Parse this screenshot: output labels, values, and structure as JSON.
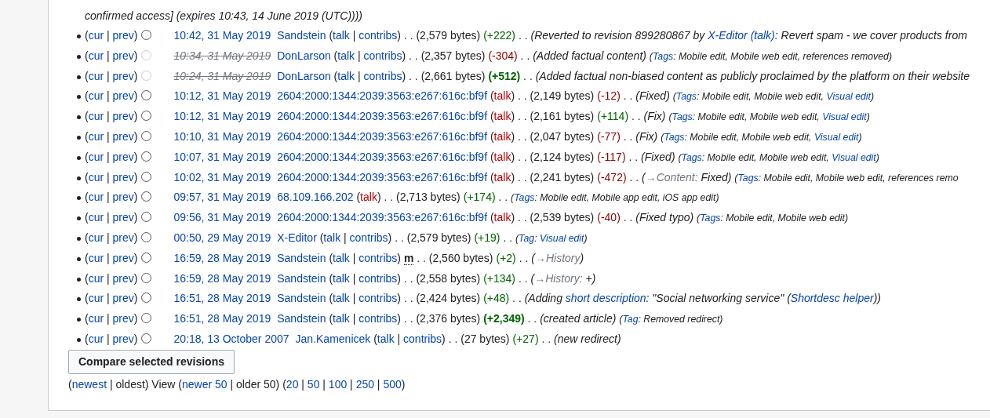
{
  "continuation": [
    {
      "kind": "comment",
      "text": "confirmed access] (expires 10:43, 14 June 2019 (UTC))))"
    }
  ],
  "rows": [
    {
      "segments": [
        {
          "kind": "punct",
          "text": "("
        },
        {
          "kind": "link",
          "text": "cur"
        },
        {
          "kind": "punct",
          "text": " | "
        },
        {
          "kind": "link",
          "text": "prev"
        },
        {
          "kind": "punct",
          "text": ")"
        },
        {
          "kind": "radio",
          "disabled": false
        },
        {
          "kind": "date",
          "text": "10:42, 31 May 2019"
        },
        {
          "kind": "link",
          "text": "Sandstein"
        },
        {
          "kind": "punct",
          "text": " ("
        },
        {
          "kind": "link",
          "text": "talk"
        },
        {
          "kind": "punct",
          "text": " | "
        },
        {
          "kind": "link",
          "text": "contribs"
        },
        {
          "kind": "punct",
          "text": ") . . "
        },
        {
          "kind": "size",
          "text": "(2,579 bytes)"
        },
        {
          "kind": "diff_pos",
          "text": "(+222)"
        },
        {
          "kind": "punct",
          "text": " . . "
        },
        {
          "kind": "comment",
          "text": "(Reverted to revision 899280867 by "
        },
        {
          "kind": "comment_link",
          "text": "X-Editor"
        },
        {
          "kind": "comment_link",
          "text": " (talk)"
        },
        {
          "kind": "comment",
          "text": ": Revert spam - we cover products from"
        }
      ]
    },
    {
      "segments": [
        {
          "kind": "punct",
          "text": "("
        },
        {
          "kind": "link",
          "text": "cur"
        },
        {
          "kind": "punct",
          "text": " | "
        },
        {
          "kind": "link",
          "text": "prev"
        },
        {
          "kind": "punct",
          "text": ")"
        },
        {
          "kind": "radio",
          "disabled": true
        },
        {
          "kind": "date_deleted",
          "text": "10:34, 31 May 2019"
        },
        {
          "kind": "link",
          "text": "DonLarson"
        },
        {
          "kind": "punct",
          "text": " ("
        },
        {
          "kind": "link",
          "text": "talk"
        },
        {
          "kind": "punct",
          "text": " | "
        },
        {
          "kind": "link",
          "text": "contribs"
        },
        {
          "kind": "punct",
          "text": ") . . "
        },
        {
          "kind": "size",
          "text": "(2,357 bytes)"
        },
        {
          "kind": "diff_neg",
          "text": "(-304)"
        },
        {
          "kind": "punct",
          "text": " . . "
        },
        {
          "kind": "comment",
          "text": "(Added factual content) "
        },
        {
          "kind": "tag",
          "text": "("
        },
        {
          "kind": "tag_label",
          "text": "Tags"
        },
        {
          "kind": "tag",
          "text": ": Mobile edit, Mobile web edit, references removed)"
        }
      ]
    },
    {
      "segments": [
        {
          "kind": "punct",
          "text": "("
        },
        {
          "kind": "link",
          "text": "cur"
        },
        {
          "kind": "punct",
          "text": " | "
        },
        {
          "kind": "link",
          "text": "prev"
        },
        {
          "kind": "punct",
          "text": ")"
        },
        {
          "kind": "radio",
          "disabled": true
        },
        {
          "kind": "date_deleted",
          "text": "10:24, 31 May 2019"
        },
        {
          "kind": "link",
          "text": "DonLarson"
        },
        {
          "kind": "punct",
          "text": " ("
        },
        {
          "kind": "link",
          "text": "talk"
        },
        {
          "kind": "punct",
          "text": " | "
        },
        {
          "kind": "link",
          "text": "contribs"
        },
        {
          "kind": "punct",
          "text": ") . . "
        },
        {
          "kind": "size",
          "text": "(2,661 bytes)"
        },
        {
          "kind": "diff_pos_big",
          "text": "(+512)"
        },
        {
          "kind": "punct",
          "text": " . . "
        },
        {
          "kind": "comment",
          "text": "(Added factual non-biased content as publicly proclaimed by the platform on their website"
        }
      ]
    },
    {
      "segments": [
        {
          "kind": "punct",
          "text": "("
        },
        {
          "kind": "link",
          "text": "cur"
        },
        {
          "kind": "punct",
          "text": " | "
        },
        {
          "kind": "link",
          "text": "prev"
        },
        {
          "kind": "punct",
          "text": ")"
        },
        {
          "kind": "radio",
          "disabled": false
        },
        {
          "kind": "date",
          "text": "10:12, 31 May 2019"
        },
        {
          "kind": "link",
          "text": "2604:2000:1344:2039:3563:e267:616c:bf9f"
        },
        {
          "kind": "punct",
          "text": " ("
        },
        {
          "kind": "redlink",
          "text": "talk"
        },
        {
          "kind": "punct",
          "text": ") . . "
        },
        {
          "kind": "size",
          "text": "(2,149 bytes)"
        },
        {
          "kind": "diff_neg",
          "text": "(-12)"
        },
        {
          "kind": "punct",
          "text": " . . "
        },
        {
          "kind": "comment",
          "text": "(Fixed) "
        },
        {
          "kind": "tag",
          "text": "("
        },
        {
          "kind": "tag_label",
          "text": "Tags"
        },
        {
          "kind": "tag",
          "text": ": Mobile edit, Mobile web edit, "
        },
        {
          "kind": "tag_link",
          "text": "Visual edit"
        },
        {
          "kind": "tag",
          "text": ")"
        }
      ]
    },
    {
      "segments": [
        {
          "kind": "punct",
          "text": "("
        },
        {
          "kind": "link",
          "text": "cur"
        },
        {
          "kind": "punct",
          "text": " | "
        },
        {
          "kind": "link",
          "text": "prev"
        },
        {
          "kind": "punct",
          "text": ")"
        },
        {
          "kind": "radio",
          "disabled": false
        },
        {
          "kind": "date",
          "text": "10:12, 31 May 2019"
        },
        {
          "kind": "link",
          "text": "2604:2000:1344:2039:3563:e267:616c:bf9f"
        },
        {
          "kind": "punct",
          "text": " ("
        },
        {
          "kind": "redlink",
          "text": "talk"
        },
        {
          "kind": "punct",
          "text": ") . . "
        },
        {
          "kind": "size",
          "text": "(2,161 bytes)"
        },
        {
          "kind": "diff_pos",
          "text": "(+114)"
        },
        {
          "kind": "punct",
          "text": " . . "
        },
        {
          "kind": "comment",
          "text": "(Fix) "
        },
        {
          "kind": "tag",
          "text": "("
        },
        {
          "kind": "tag_label",
          "text": "Tags"
        },
        {
          "kind": "tag",
          "text": ": Mobile edit, Mobile web edit, "
        },
        {
          "kind": "tag_link",
          "text": "Visual edit"
        },
        {
          "kind": "tag",
          "text": ")"
        }
      ]
    },
    {
      "segments": [
        {
          "kind": "punct",
          "text": "("
        },
        {
          "kind": "link",
          "text": "cur"
        },
        {
          "kind": "punct",
          "text": " | "
        },
        {
          "kind": "link",
          "text": "prev"
        },
        {
          "kind": "punct",
          "text": ")"
        },
        {
          "kind": "radio",
          "disabled": false
        },
        {
          "kind": "date",
          "text": "10:10, 31 May 2019"
        },
        {
          "kind": "link",
          "text": "2604:2000:1344:2039:3563:e267:616c:bf9f"
        },
        {
          "kind": "punct",
          "text": " ("
        },
        {
          "kind": "redlink",
          "text": "talk"
        },
        {
          "kind": "punct",
          "text": ") . . "
        },
        {
          "kind": "size",
          "text": "(2,047 bytes)"
        },
        {
          "kind": "diff_neg",
          "text": "(-77)"
        },
        {
          "kind": "punct",
          "text": " . . "
        },
        {
          "kind": "comment",
          "text": "(Fix) "
        },
        {
          "kind": "tag",
          "text": "("
        },
        {
          "kind": "tag_label",
          "text": "Tags"
        },
        {
          "kind": "tag",
          "text": ": Mobile edit, Mobile web edit, "
        },
        {
          "kind": "tag_link",
          "text": "Visual edit"
        },
        {
          "kind": "tag",
          "text": ")"
        }
      ]
    },
    {
      "segments": [
        {
          "kind": "punct",
          "text": "("
        },
        {
          "kind": "link",
          "text": "cur"
        },
        {
          "kind": "punct",
          "text": " | "
        },
        {
          "kind": "link",
          "text": "prev"
        },
        {
          "kind": "punct",
          "text": ")"
        },
        {
          "kind": "radio",
          "disabled": false
        },
        {
          "kind": "date",
          "text": "10:07, 31 May 2019"
        },
        {
          "kind": "link",
          "text": "2604:2000:1344:2039:3563:e267:616c:bf9f"
        },
        {
          "kind": "punct",
          "text": " ("
        },
        {
          "kind": "redlink",
          "text": "talk"
        },
        {
          "kind": "punct",
          "text": ") . . "
        },
        {
          "kind": "size",
          "text": "(2,124 bytes)"
        },
        {
          "kind": "diff_neg",
          "text": "(-117)"
        },
        {
          "kind": "punct",
          "text": " . . "
        },
        {
          "kind": "comment",
          "text": "(Fixed) "
        },
        {
          "kind": "tag",
          "text": "("
        },
        {
          "kind": "tag_label",
          "text": "Tags"
        },
        {
          "kind": "tag",
          "text": ": Mobile edit, Mobile web edit, "
        },
        {
          "kind": "tag_link",
          "text": "Visual edit"
        },
        {
          "kind": "tag",
          "text": ")"
        }
      ]
    },
    {
      "segments": [
        {
          "kind": "punct",
          "text": "("
        },
        {
          "kind": "link",
          "text": "cur"
        },
        {
          "kind": "punct",
          "text": " | "
        },
        {
          "kind": "link",
          "text": "prev"
        },
        {
          "kind": "punct",
          "text": ")"
        },
        {
          "kind": "radio",
          "disabled": false
        },
        {
          "kind": "date",
          "text": "10:02, 31 May 2019"
        },
        {
          "kind": "link",
          "text": "2604:2000:1344:2039:3563:e267:616c:bf9f"
        },
        {
          "kind": "punct",
          "text": " ("
        },
        {
          "kind": "redlink",
          "text": "talk"
        },
        {
          "kind": "punct",
          "text": ") . . "
        },
        {
          "kind": "size",
          "text": "(2,241 bytes)"
        },
        {
          "kind": "diff_neg",
          "text": "(-472)"
        },
        {
          "kind": "punct",
          "text": " . . "
        },
        {
          "kind": "comment",
          "text": "("
        },
        {
          "kind": "section",
          "text": "→Content:"
        },
        {
          "kind": "comment",
          "text": " Fixed) "
        },
        {
          "kind": "tag",
          "text": "("
        },
        {
          "kind": "tag_label",
          "text": "Tags"
        },
        {
          "kind": "tag",
          "text": ": Mobile edit, Mobile web edit, references remo"
        }
      ]
    },
    {
      "segments": [
        {
          "kind": "punct",
          "text": "("
        },
        {
          "kind": "link",
          "text": "cur"
        },
        {
          "kind": "punct",
          "text": " | "
        },
        {
          "kind": "link",
          "text": "prev"
        },
        {
          "kind": "punct",
          "text": ")"
        },
        {
          "kind": "radio",
          "disabled": false
        },
        {
          "kind": "date",
          "text": "09:57, 31 May 2019"
        },
        {
          "kind": "link",
          "text": "68.109.166.202"
        },
        {
          "kind": "punct",
          "text": " ("
        },
        {
          "kind": "redlink",
          "text": "talk"
        },
        {
          "kind": "punct",
          "text": ") . . "
        },
        {
          "kind": "size",
          "text": "(2,713 bytes)"
        },
        {
          "kind": "diff_pos",
          "text": "(+174)"
        },
        {
          "kind": "punct",
          "text": " . . "
        },
        {
          "kind": "tag",
          "text": "("
        },
        {
          "kind": "tag_label",
          "text": "Tags"
        },
        {
          "kind": "tag",
          "text": ": Mobile edit, Mobile app edit, iOS app edit)"
        }
      ]
    },
    {
      "segments": [
        {
          "kind": "punct",
          "text": "("
        },
        {
          "kind": "link",
          "text": "cur"
        },
        {
          "kind": "punct",
          "text": " | "
        },
        {
          "kind": "link",
          "text": "prev"
        },
        {
          "kind": "punct",
          "text": ")"
        },
        {
          "kind": "radio",
          "disabled": false
        },
        {
          "kind": "date",
          "text": "09:56, 31 May 2019"
        },
        {
          "kind": "link",
          "text": "2604:2000:1344:2039:3563:e267:616c:bf9f"
        },
        {
          "kind": "punct",
          "text": " ("
        },
        {
          "kind": "redlink",
          "text": "talk"
        },
        {
          "kind": "punct",
          "text": ") . . "
        },
        {
          "kind": "size",
          "text": "(2,539 bytes)"
        },
        {
          "kind": "diff_neg",
          "text": "(-40)"
        },
        {
          "kind": "punct",
          "text": " . . "
        },
        {
          "kind": "comment",
          "text": "(Fixed typo) "
        },
        {
          "kind": "tag",
          "text": "("
        },
        {
          "kind": "tag_label",
          "text": "Tags"
        },
        {
          "kind": "tag",
          "text": ": Mobile edit, Mobile web edit)"
        }
      ]
    },
    {
      "segments": [
        {
          "kind": "punct",
          "text": "("
        },
        {
          "kind": "link",
          "text": "cur"
        },
        {
          "kind": "punct",
          "text": " | "
        },
        {
          "kind": "link",
          "text": "prev"
        },
        {
          "kind": "punct",
          "text": ")"
        },
        {
          "kind": "radio",
          "disabled": false
        },
        {
          "kind": "date",
          "text": "00:50, 29 May 2019"
        },
        {
          "kind": "link",
          "text": "X-Editor"
        },
        {
          "kind": "punct",
          "text": " ("
        },
        {
          "kind": "link",
          "text": "talk"
        },
        {
          "kind": "punct",
          "text": " | "
        },
        {
          "kind": "link",
          "text": "contribs"
        },
        {
          "kind": "punct",
          "text": ") . . "
        },
        {
          "kind": "size",
          "text": "(2,579 bytes)"
        },
        {
          "kind": "diff_pos",
          "text": "(+19)"
        },
        {
          "kind": "punct",
          "text": " . . "
        },
        {
          "kind": "tag",
          "text": "("
        },
        {
          "kind": "tag_label",
          "text": "Tag"
        },
        {
          "kind": "tag",
          "text": ": "
        },
        {
          "kind": "tag_link",
          "text": "Visual edit"
        },
        {
          "kind": "tag",
          "text": ")"
        }
      ]
    },
    {
      "segments": [
        {
          "kind": "punct",
          "text": "("
        },
        {
          "kind": "link",
          "text": "cur"
        },
        {
          "kind": "punct",
          "text": " | "
        },
        {
          "kind": "link",
          "text": "prev"
        },
        {
          "kind": "punct",
          "text": ")"
        },
        {
          "kind": "radio",
          "disabled": false
        },
        {
          "kind": "date",
          "text": "16:59, 28 May 2019"
        },
        {
          "kind": "link",
          "text": "Sandstein"
        },
        {
          "kind": "punct",
          "text": " ("
        },
        {
          "kind": "link",
          "text": "talk"
        },
        {
          "kind": "punct",
          "text": " | "
        },
        {
          "kind": "link",
          "text": "contribs"
        },
        {
          "kind": "punct",
          "text": ") "
        },
        {
          "kind": "minor",
          "text": "m"
        },
        {
          "kind": "punct",
          "text": " . . "
        },
        {
          "kind": "size",
          "text": "(2,560 bytes)"
        },
        {
          "kind": "diff_pos",
          "text": "(+2)"
        },
        {
          "kind": "punct",
          "text": " . . "
        },
        {
          "kind": "comment",
          "text": "("
        },
        {
          "kind": "section",
          "text": "→History"
        },
        {
          "kind": "comment",
          "text": ")"
        }
      ]
    },
    {
      "segments": [
        {
          "kind": "punct",
          "text": "("
        },
        {
          "kind": "link",
          "text": "cur"
        },
        {
          "kind": "punct",
          "text": " | "
        },
        {
          "kind": "link",
          "text": "prev"
        },
        {
          "kind": "punct",
          "text": ")"
        },
        {
          "kind": "radio",
          "disabled": false
        },
        {
          "kind": "date",
          "text": "16:59, 28 May 2019"
        },
        {
          "kind": "link",
          "text": "Sandstein"
        },
        {
          "kind": "punct",
          "text": " ("
        },
        {
          "kind": "link",
          "text": "talk"
        },
        {
          "kind": "punct",
          "text": " | "
        },
        {
          "kind": "link",
          "text": "contribs"
        },
        {
          "kind": "punct",
          "text": ") . . "
        },
        {
          "kind": "size",
          "text": "(2,558 bytes)"
        },
        {
          "kind": "diff_pos",
          "text": "(+134)"
        },
        {
          "kind": "punct",
          "text": " . . "
        },
        {
          "kind": "comment",
          "text": "("
        },
        {
          "kind": "section",
          "text": "→History:"
        },
        {
          "kind": "comment",
          "text": " +)"
        }
      ]
    },
    {
      "segments": [
        {
          "kind": "punct",
          "text": "("
        },
        {
          "kind": "link",
          "text": "cur"
        },
        {
          "kind": "punct",
          "text": " | "
        },
        {
          "kind": "link",
          "text": "prev"
        },
        {
          "kind": "punct",
          "text": ")"
        },
        {
          "kind": "radio",
          "disabled": false
        },
        {
          "kind": "date",
          "text": "16:51, 28 May 2019"
        },
        {
          "kind": "link",
          "text": "Sandstein"
        },
        {
          "kind": "punct",
          "text": " ("
        },
        {
          "kind": "link",
          "text": "talk"
        },
        {
          "kind": "punct",
          "text": " | "
        },
        {
          "kind": "link",
          "text": "contribs"
        },
        {
          "kind": "punct",
          "text": ") . . "
        },
        {
          "kind": "size",
          "text": "(2,424 bytes)"
        },
        {
          "kind": "diff_pos",
          "text": "(+48)"
        },
        {
          "kind": "punct",
          "text": " . . "
        },
        {
          "kind": "comment",
          "text": "(Adding "
        },
        {
          "kind": "comment_link",
          "text": "short description"
        },
        {
          "kind": "comment",
          "text": ": \"Social networking service\" ("
        },
        {
          "kind": "comment_link",
          "text": "Shortdesc helper"
        },
        {
          "kind": "comment",
          "text": "))"
        }
      ]
    },
    {
      "segments": [
        {
          "kind": "punct",
          "text": "("
        },
        {
          "kind": "link",
          "text": "cur"
        },
        {
          "kind": "punct",
          "text": " | "
        },
        {
          "kind": "link",
          "text": "prev"
        },
        {
          "kind": "punct",
          "text": ")"
        },
        {
          "kind": "radio",
          "disabled": false
        },
        {
          "kind": "date",
          "text": "16:51, 28 May 2019"
        },
        {
          "kind": "link",
          "text": "Sandstein"
        },
        {
          "kind": "punct",
          "text": " ("
        },
        {
          "kind": "link",
          "text": "talk"
        },
        {
          "kind": "punct",
          "text": " | "
        },
        {
          "kind": "link",
          "text": "contribs"
        },
        {
          "kind": "punct",
          "text": ") . . "
        },
        {
          "kind": "size",
          "text": "(2,376 bytes)"
        },
        {
          "kind": "diff_pos_big",
          "text": "(+2,349)"
        },
        {
          "kind": "punct",
          "text": " . . "
        },
        {
          "kind": "comment",
          "text": "(created article) "
        },
        {
          "kind": "tag",
          "text": "("
        },
        {
          "kind": "tag_label",
          "text": "Tag"
        },
        {
          "kind": "tag",
          "text": ": Removed redirect)"
        }
      ]
    },
    {
      "segments": [
        {
          "kind": "punct",
          "text": "("
        },
        {
          "kind": "link",
          "text": "cur"
        },
        {
          "kind": "punct",
          "text": " | "
        },
        {
          "kind": "link",
          "text": "prev"
        },
        {
          "kind": "punct",
          "text": ")"
        },
        {
          "kind": "radio",
          "disabled": false
        },
        {
          "kind": "date",
          "text": "20:18, 13 October 2007"
        },
        {
          "kind": "link",
          "text": "Jan.Kamenicek"
        },
        {
          "kind": "punct",
          "text": " ("
        },
        {
          "kind": "link",
          "text": "talk"
        },
        {
          "kind": "punct",
          "text": " | "
        },
        {
          "kind": "link",
          "text": "contribs"
        },
        {
          "kind": "punct",
          "text": ") . . "
        },
        {
          "kind": "size",
          "text": "(27 bytes)"
        },
        {
          "kind": "diff_pos",
          "text": "(+27)"
        },
        {
          "kind": "punct",
          "text": " . . "
        },
        {
          "kind": "comment",
          "text": "(new redirect)"
        }
      ]
    }
  ],
  "compare_button": "Compare selected revisions",
  "navigation": [
    {
      "kind": "punct",
      "text": "("
    },
    {
      "kind": "link",
      "text": "newest"
    },
    {
      "kind": "punct",
      "text": " | oldest) View ("
    },
    {
      "kind": "link",
      "text": "newer 50"
    },
    {
      "kind": "punct",
      "text": " | older 50) ("
    },
    {
      "kind": "link",
      "text": "20"
    },
    {
      "kind": "punct",
      "text": " | "
    },
    {
      "kind": "link",
      "text": "50"
    },
    {
      "kind": "punct",
      "text": " | "
    },
    {
      "kind": "link",
      "text": "100"
    },
    {
      "kind": "punct",
      "text": " | "
    },
    {
      "kind": "link",
      "text": "250"
    },
    {
      "kind": "punct",
      "text": " | "
    },
    {
      "kind": "link",
      "text": "500"
    },
    {
      "kind": "punct",
      "text": ")"
    }
  ]
}
